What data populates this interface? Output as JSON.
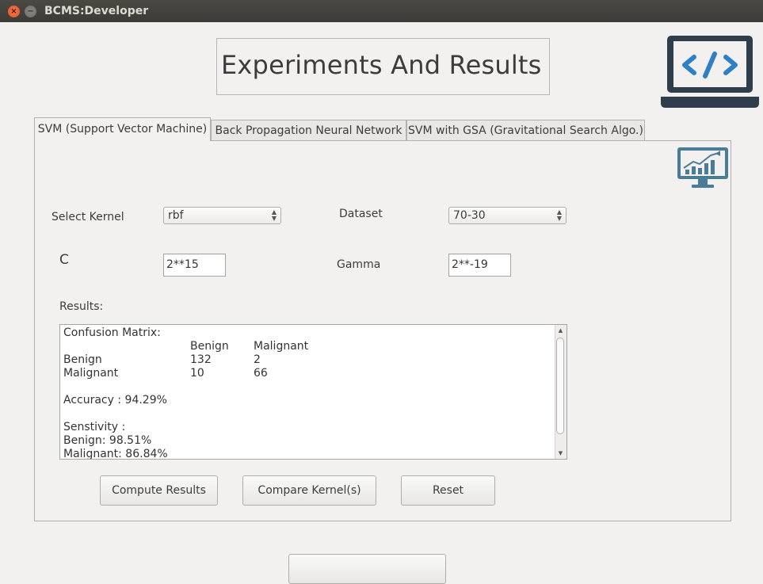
{
  "window": {
    "title": "BCMS:Developer",
    "close_glyph": "×",
    "minimize_glyph": "−"
  },
  "header": {
    "title": "Experiments And Results",
    "icon": "laptop-code-icon"
  },
  "tabs": [
    {
      "label": "SVM (Support Vector Machine)",
      "active": true
    },
    {
      "label": "Back Propagation Neural Network",
      "active": false
    },
    {
      "label": "SVM with GSA (Gravitational Search Algo.)",
      "active": false
    }
  ],
  "panel": {
    "chart_icon": "monitor-chart-icon",
    "select_kernel_label": "Select Kernel",
    "kernel_value": "rbf",
    "dataset_label": "Dataset",
    "dataset_value": "70-30",
    "c_label": "C",
    "c_value": "2**15",
    "gamma_label": "Gamma",
    "gamma_value": "2**-19",
    "results_label": "Results:",
    "results": {
      "confusion_title": "Confusion Matrix:",
      "header": {
        "col1": "Benign",
        "col2": "Malignant"
      },
      "rows": [
        {
          "label": "Benign",
          "v1": "132",
          "v2": "2"
        },
        {
          "label": "Malignant",
          "v1": "10",
          "v2": "66"
        }
      ],
      "accuracy": "Accuracy : 94.29%",
      "sensitivity_title": "Senstivity :",
      "sens_benign": "Benign: 98.51%",
      "sens_malignant": "Malignant: 86.84%"
    },
    "buttons": {
      "compute": "Compute Results",
      "compare": "Compare Kernel(s)",
      "reset": "Reset"
    }
  },
  "colors": {
    "titlebar": "#3c3b37",
    "close": "#e0541f",
    "icon_blue": "#2f7fc7",
    "icon_dark": "#2f3d4c"
  }
}
